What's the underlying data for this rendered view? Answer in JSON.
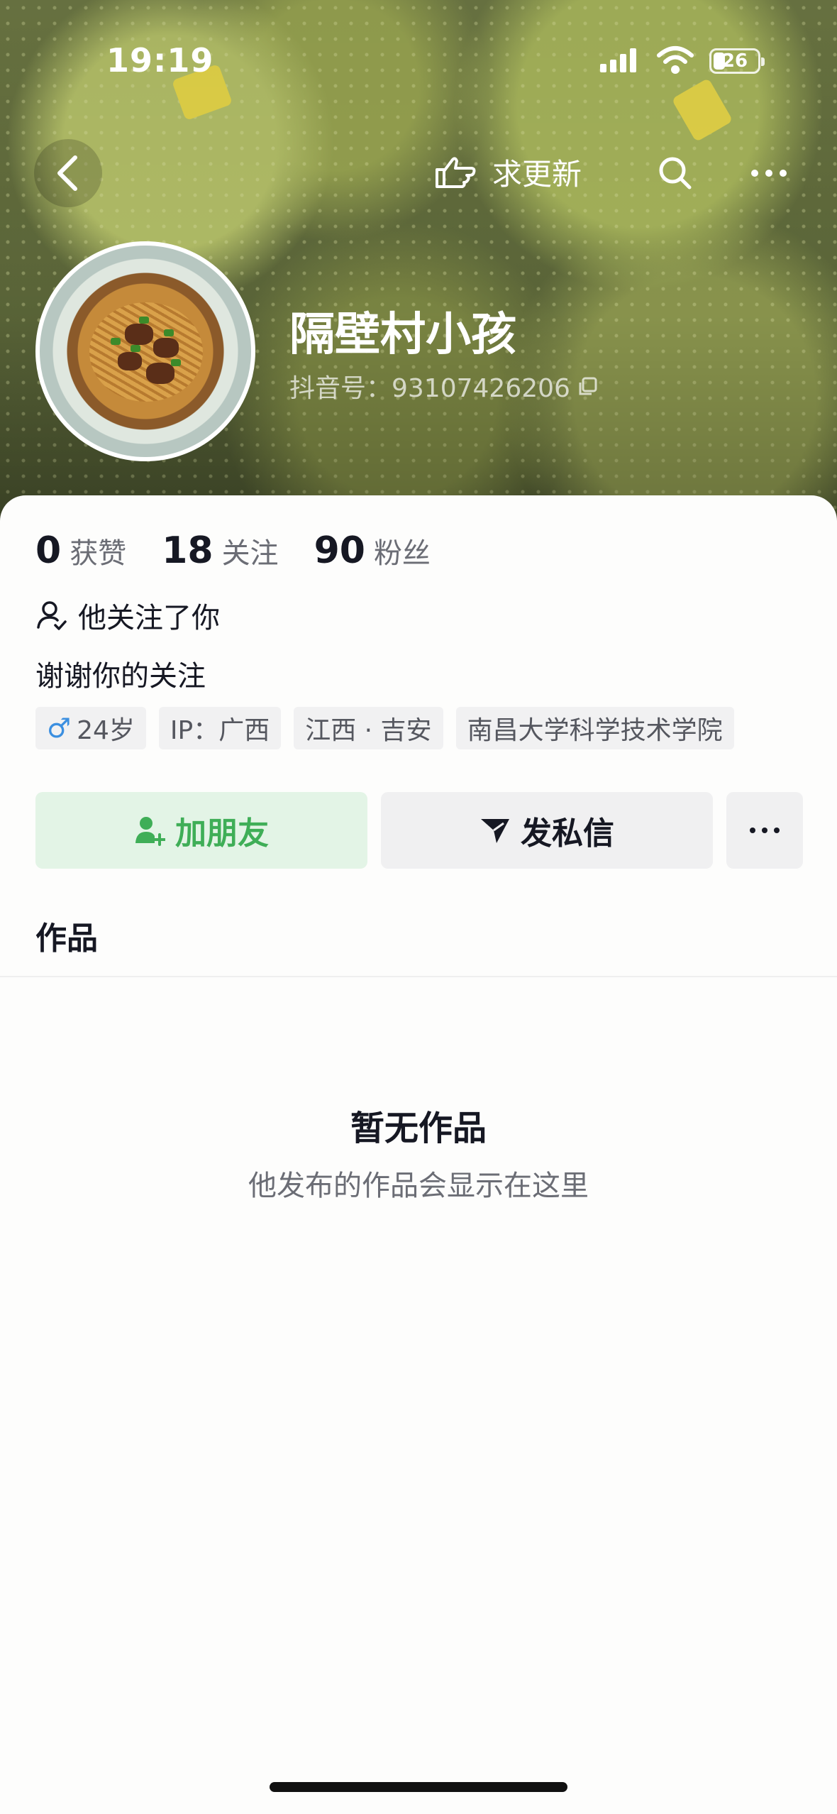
{
  "status_bar": {
    "time": "19:19",
    "battery": "26"
  },
  "nav": {
    "request_update_label": "求更新"
  },
  "profile": {
    "name": "隔壁村小孩",
    "douyin_id": "抖音号：93107426206"
  },
  "stats": [
    {
      "num": "0",
      "label": "获赞"
    },
    {
      "num": "18",
      "label": "关注"
    },
    {
      "num": "90",
      "label": "粉丝"
    }
  ],
  "follows_you": "他关注了你",
  "bio": "谢谢你的关注",
  "tags": {
    "gender_symbol": "♂",
    "age": "24岁",
    "ip": "IP：广西",
    "location": "江西 · 吉安",
    "school": "南昌大学科学技术学院"
  },
  "actions": {
    "add_friend": "加朋友",
    "message": "发私信"
  },
  "tabs": {
    "works": "作品"
  },
  "empty": {
    "title": "暂无作品",
    "subtitle": "他发布的作品会显示在这里"
  },
  "colors": {
    "accent_green": "#3fae57",
    "add_bg": "#e3f4e6",
    "male_blue": "#3b8fe0"
  }
}
